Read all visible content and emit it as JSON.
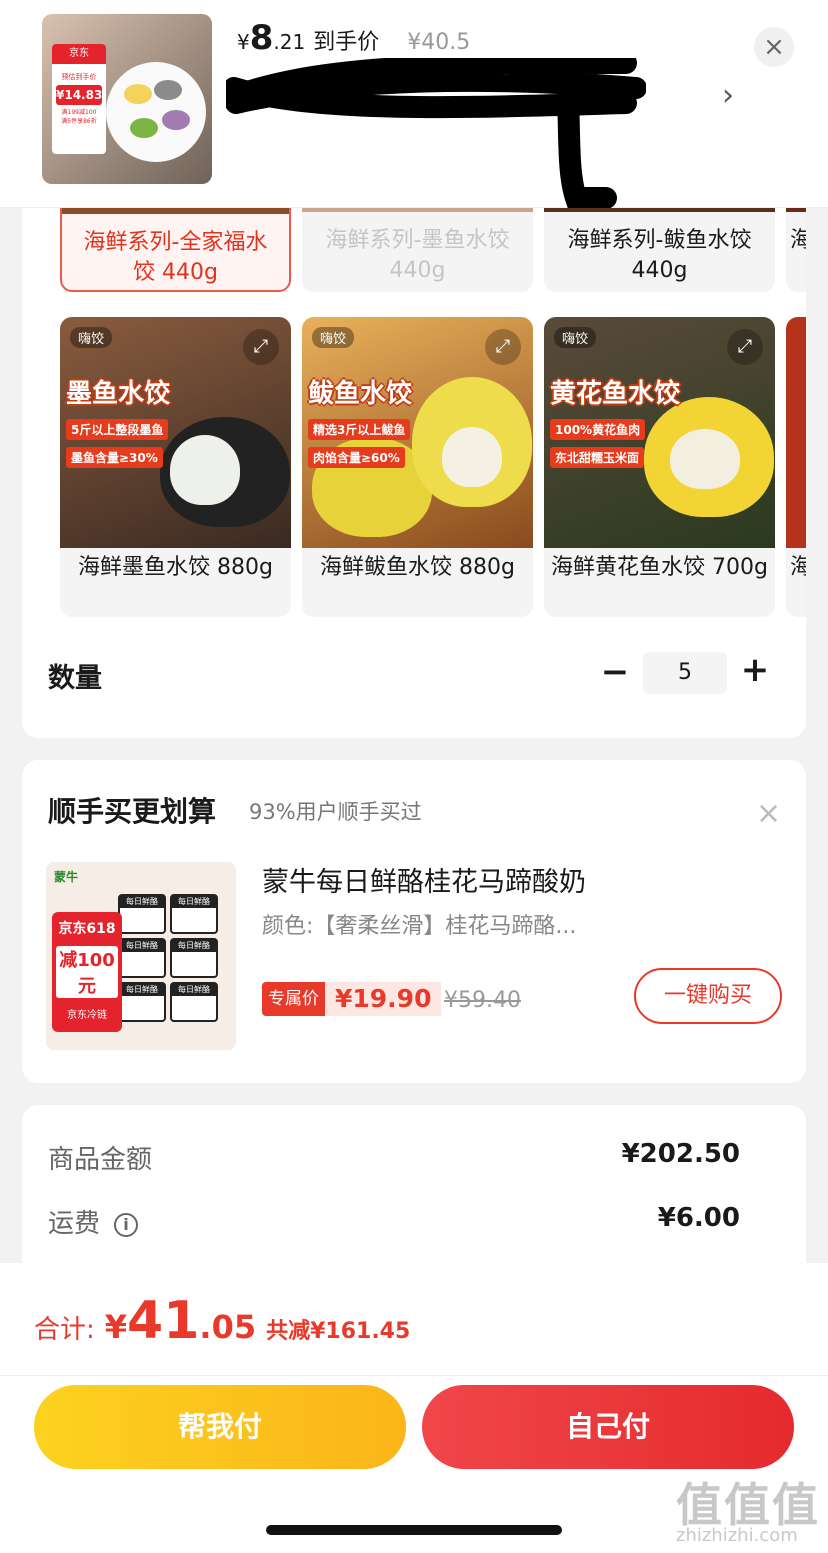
{
  "header": {
    "price_currency": "¥",
    "price_int": "8",
    "price_dec": ".21",
    "price_label": "到手价",
    "original_price": "¥40.5",
    "thumb_brand": "京东",
    "thumb_price_label": "预估到手价",
    "thumb_price": "¥14.83",
    "thumb_promo1": "满199减100",
    "thumb_promo2": "满5件享86折",
    "close_icon": "close-icon",
    "arrow_icon": "chevron-right-icon"
  },
  "variants": {
    "row1": [
      {
        "label": "海鲜系列-全家福水饺 440g",
        "state": "selected"
      },
      {
        "label": "海鲜系列-墨鱼水饺 440g",
        "state": "disabled"
      },
      {
        "label": "海鲜系列-鲅鱼水饺 440g",
        "state": "normal"
      },
      {
        "label": "海",
        "state": "normal"
      }
    ],
    "row2": [
      {
        "label": "海鲜墨鱼水饺 880g",
        "brand": "嗨饺",
        "title": "墨鱼水饺",
        "tag1": "5斤以上整段墨鱼",
        "tag2": "墨鱼含量≥30%"
      },
      {
        "label": "海鲜鲅鱼水饺 880g",
        "brand": "嗨饺",
        "title": "鲅鱼水饺",
        "tag1": "精选3斤以上鲅鱼",
        "tag2": "肉馅含量≥60%"
      },
      {
        "label": "海鲜黄花鱼水饺 700g",
        "brand": "嗨饺",
        "title": "黄花鱼水饺",
        "tag1": "100%黄花鱼肉",
        "tag2": "东北甜糯玉米面"
      },
      {
        "label": "海",
        "brand": "",
        "title": "",
        "tag1": "",
        "tag2": ""
      }
    ]
  },
  "quantity": {
    "label": "数量",
    "minus": "−",
    "value": "5",
    "plus": "+"
  },
  "upsell": {
    "title": "顺手买更划算",
    "subtitle": "93%用户顺手买过",
    "close": "×",
    "product_name": "蒙牛每日鲜酪桂花马蹄酸奶",
    "spec": "颜色:【奢柔丝滑】桂花马蹄酪...",
    "tag": "专属价",
    "price": "¥19.90",
    "original_price": "¥59.40",
    "buy_label": "一键购买",
    "img_brand": "蒙牛",
    "img_jd": "京东618",
    "img_coupon": "减100元",
    "img_cold": "京东冷链",
    "cup_label": "每日鲜酪"
  },
  "summary": {
    "goods_label": "商品金额",
    "goods_value": "¥202.50",
    "shipping_label": "运费",
    "shipping_value": "¥6.00"
  },
  "footer": {
    "total_label": "合计:",
    "total_currency": "¥",
    "total_int": "41",
    "total_dec": ".05",
    "saved": "共减¥161.45",
    "help_pay": "帮我付",
    "self_pay": "自己付"
  },
  "watermark": {
    "text": "值值值",
    "domain": "zhizhizhi.com"
  },
  "colors": {
    "accent": "#e8392a",
    "yellow": "#fbc21d",
    "bg": "#f2f2f2"
  }
}
